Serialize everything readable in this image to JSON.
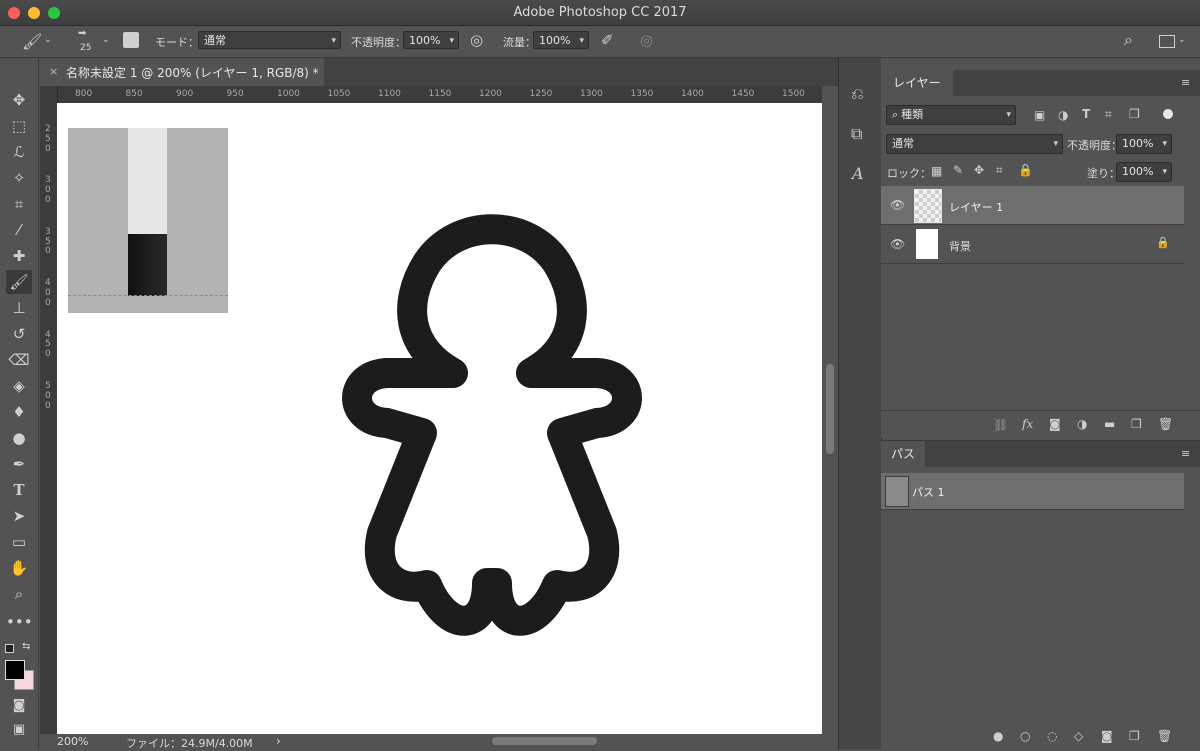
{
  "window": {
    "title": "Adobe Photoshop CC 2017"
  },
  "options_bar": {
    "brush_size": "25",
    "mode_label": "モード：",
    "mode_value": "通常",
    "opacity_label": "不透明度：",
    "opacity_value": "100%",
    "flow_label": "流量：",
    "flow_value": "100%"
  },
  "document": {
    "tab_title": "名称未設定 1 @ 200% (レイヤー 1, RGB/8) *",
    "close_glyph": "×"
  },
  "ruler": {
    "top_ticks": [
      "800",
      "850",
      "900",
      "950",
      "1000",
      "1050",
      "1100",
      "1150",
      "1200",
      "1250",
      "1300",
      "1350",
      "1400",
      "1450",
      "1500"
    ],
    "left_ticks": [
      "2",
      "5",
      "0",
      "3",
      "0",
      "0",
      "3",
      "5",
      "0",
      "4",
      "0",
      "0",
      "4",
      "5",
      "0",
      "5",
      "0",
      "0"
    ]
  },
  "status": {
    "zoom": "200%",
    "file": "ファイル：24.9M/4.00M",
    "arrow": "›"
  },
  "layers_panel": {
    "tab": "レイヤー",
    "filter_kind": "種類",
    "blend_mode": "通常",
    "opacity_label": "不透明度：",
    "opacity_value": "100%",
    "lock_label": "ロック：",
    "fill_label": "塗り：",
    "fill_value": "100%",
    "layers": [
      {
        "name": "レイヤー 1",
        "selected": true
      },
      {
        "name": "背景",
        "selected": false
      }
    ]
  },
  "paths_panel": {
    "tab": "パス",
    "paths": [
      {
        "name": "パス 1"
      }
    ]
  },
  "colors": {
    "foreground": "#000000",
    "background": "#f7d7dc",
    "selection": "#6e6e6e",
    "shape_stroke": "#1c1c1c"
  }
}
